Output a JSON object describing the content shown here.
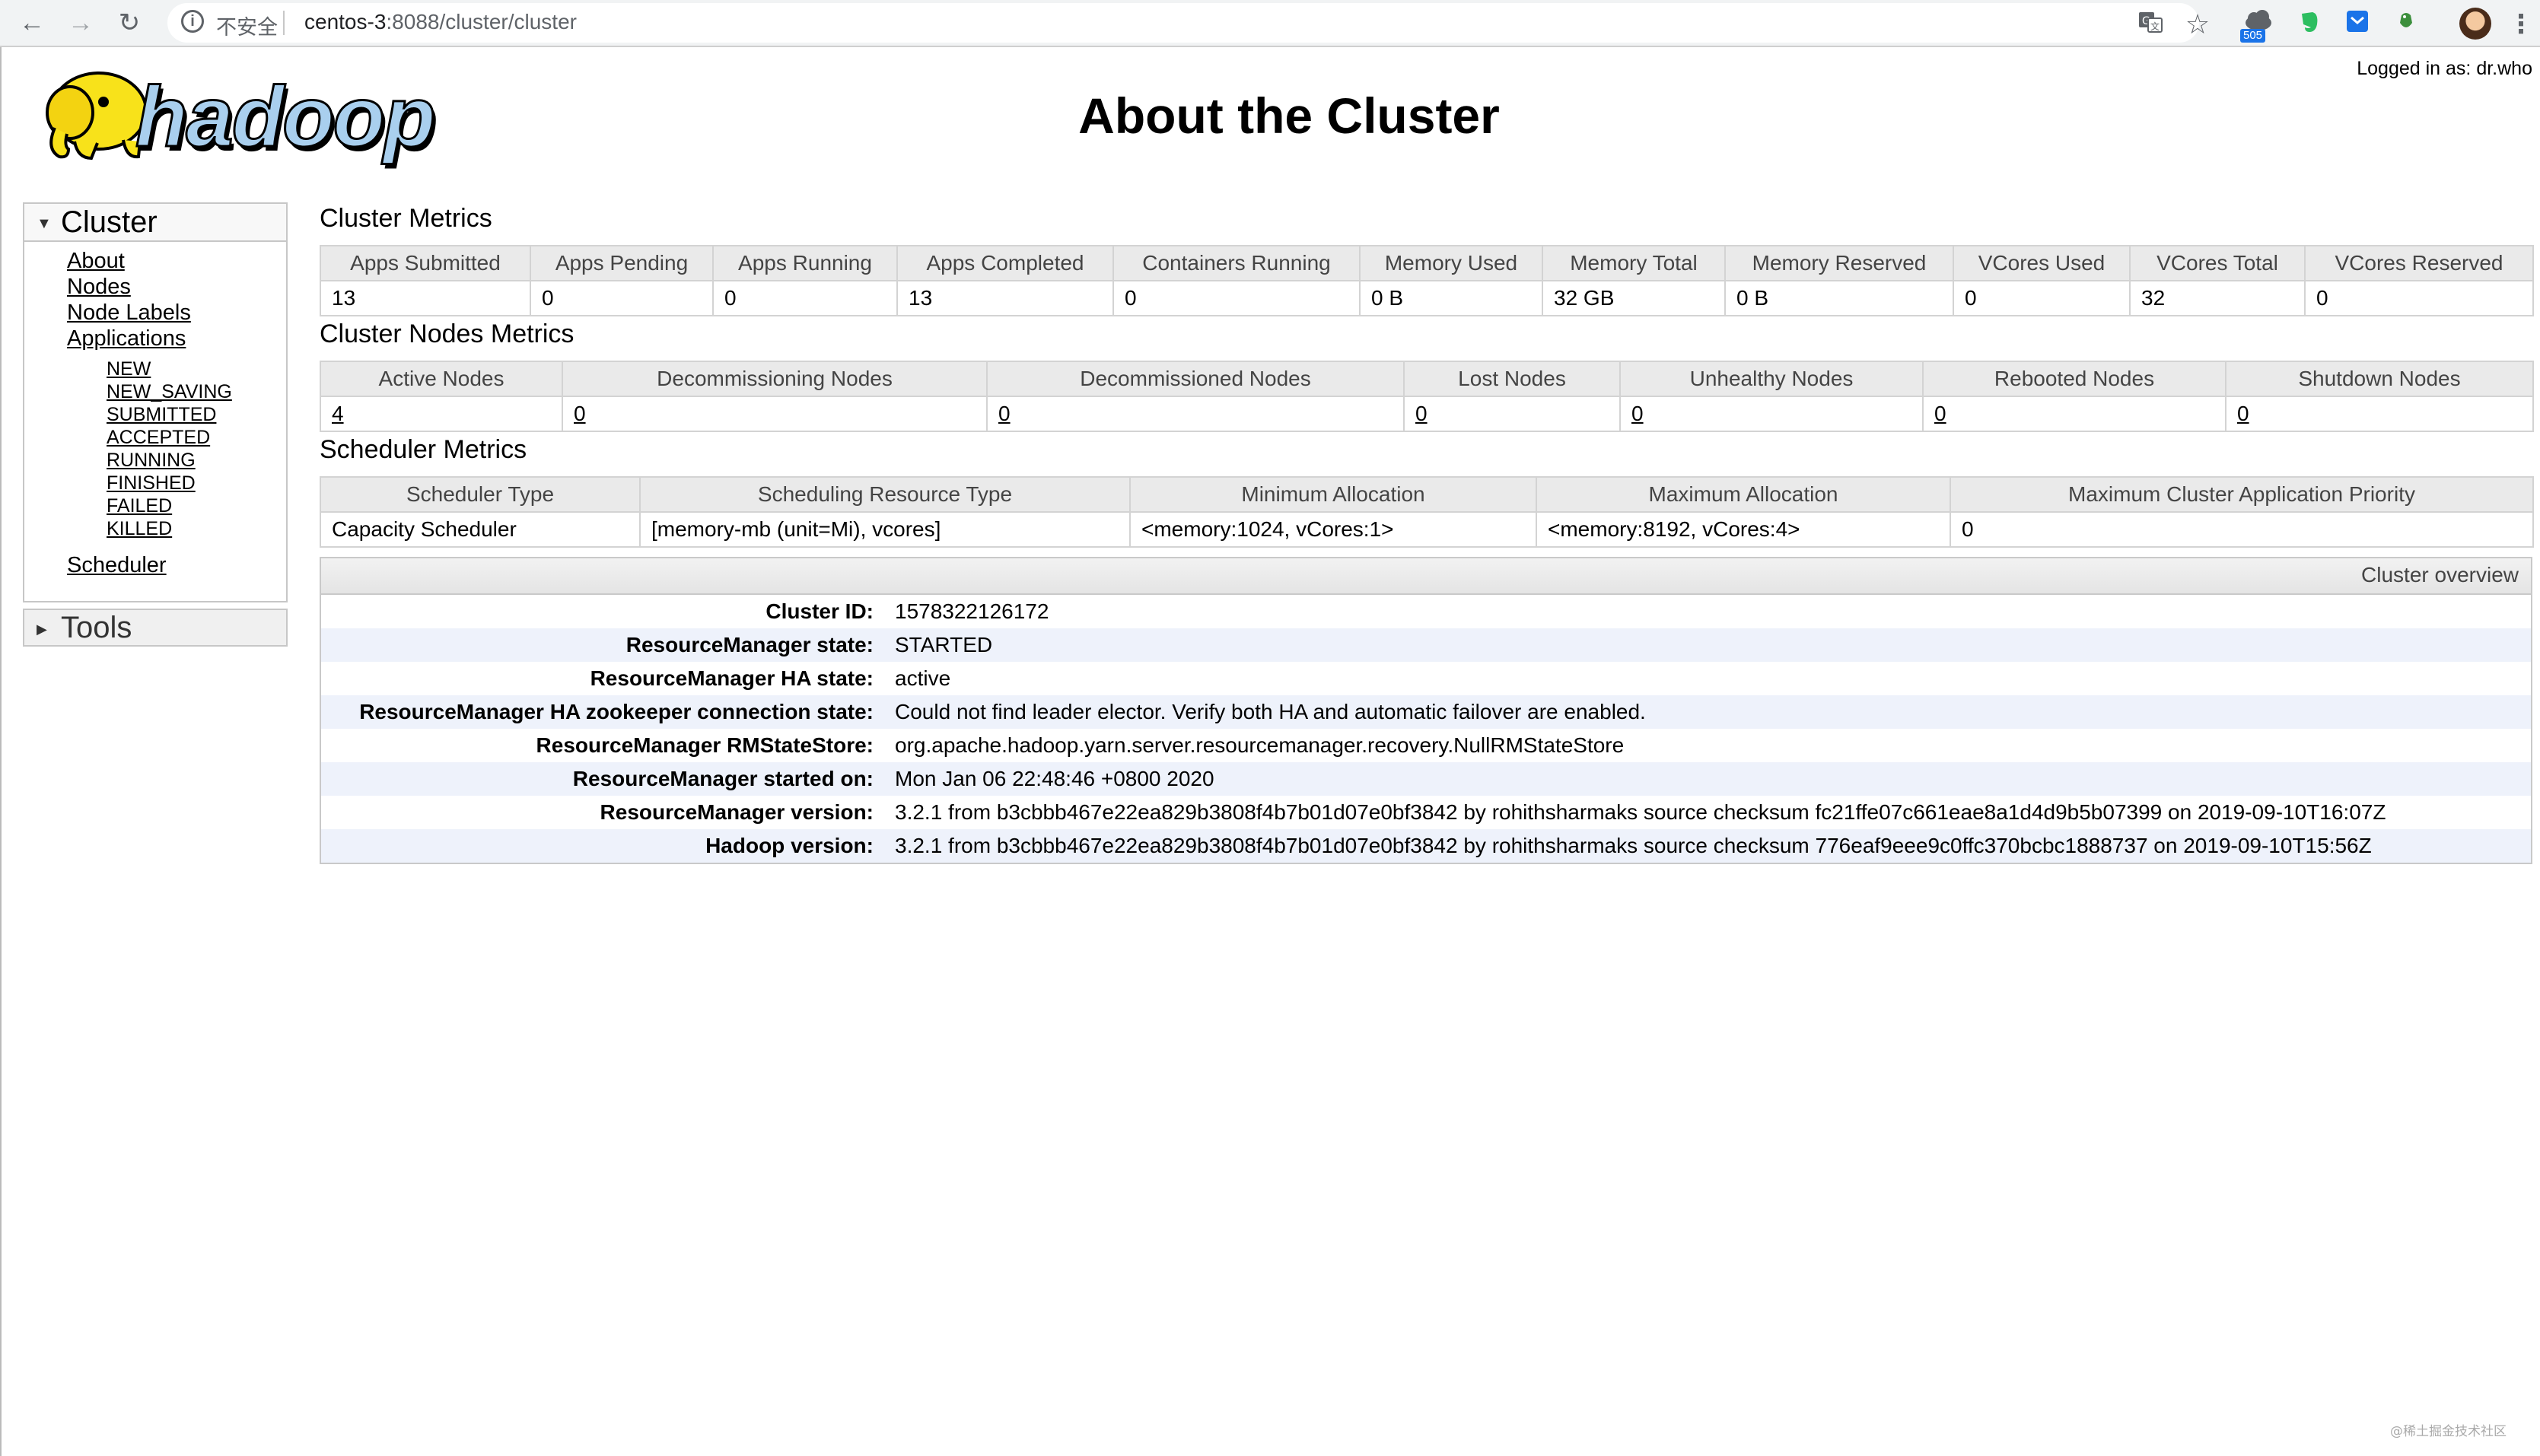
{
  "browser": {
    "back_icon": "arrow-left-icon",
    "forward_icon": "arrow-right-icon",
    "reload_icon": "reload-icon",
    "security_label": "不安全",
    "url_host": "centos-3",
    "url_path": ":8088/cluster/cluster",
    "extension_badge": "505"
  },
  "header": {
    "logo_text": "hadoop",
    "title": "About the Cluster",
    "login_label": "Logged in as: ",
    "login_user": "dr.who"
  },
  "sidebar": {
    "cluster_label": "Cluster",
    "links": {
      "about": "About",
      "nodes": "Nodes",
      "node_labels": "Node Labels",
      "applications": "Applications",
      "scheduler": "Scheduler"
    },
    "app_states": [
      "NEW",
      "NEW_SAVING",
      "SUBMITTED",
      "ACCEPTED",
      "RUNNING",
      "FINISHED",
      "FAILED",
      "KILLED"
    ],
    "tools_label": "Tools"
  },
  "cluster_metrics": {
    "title": "Cluster Metrics",
    "headers": [
      "Apps Submitted",
      "Apps Pending",
      "Apps Running",
      "Apps Completed",
      "Containers Running",
      "Memory Used",
      "Memory Total",
      "Memory Reserved",
      "VCores Used",
      "VCores Total",
      "VCores Reserved"
    ],
    "values": [
      "13",
      "0",
      "0",
      "13",
      "0",
      "0 B",
      "32 GB",
      "0 B",
      "0",
      "32",
      "0"
    ]
  },
  "node_metrics": {
    "title": "Cluster Nodes Metrics",
    "headers": [
      "Active Nodes",
      "Decommissioning Nodes",
      "Decommissioned Nodes",
      "Lost Nodes",
      "Unhealthy Nodes",
      "Rebooted Nodes",
      "Shutdown Nodes"
    ],
    "values": [
      "4",
      "0",
      "0",
      "0",
      "0",
      "0",
      "0"
    ]
  },
  "scheduler_metrics": {
    "title": "Scheduler Metrics",
    "headers": [
      "Scheduler Type",
      "Scheduling Resource Type",
      "Minimum Allocation",
      "Maximum Allocation",
      "Maximum Cluster Application Priority"
    ],
    "values": [
      "Capacity Scheduler",
      "[memory-mb (unit=Mi), vcores]",
      "<memory:1024, vCores:1>",
      "<memory:8192, vCores:4>",
      "0"
    ]
  },
  "overview": {
    "title": "Cluster overview",
    "rows": [
      {
        "label": "Cluster ID:",
        "value": "1578322126172"
      },
      {
        "label": "ResourceManager state:",
        "value": "STARTED"
      },
      {
        "label": "ResourceManager HA state:",
        "value": "active"
      },
      {
        "label": "ResourceManager HA zookeeper connection state:",
        "value": "Could not find leader elector. Verify both HA and automatic failover are enabled."
      },
      {
        "label": "ResourceManager RMStateStore:",
        "value": "org.apache.hadoop.yarn.server.resourcemanager.recovery.NullRMStateStore"
      },
      {
        "label": "ResourceManager started on:",
        "value": "Mon Jan 06 22:48:46 +0800 2020"
      },
      {
        "label": "ResourceManager version:",
        "value": "3.2.1 from b3cbbb467e22ea829b3808f4b7b01d07e0bf3842 by rohithsharmaks source checksum fc21ffe07c661eae8a1d4d9b5b07399 on 2019-09-10T16:07Z"
      },
      {
        "label": "Hadoop version:",
        "value": "3.2.1 from b3cbbb467e22ea829b3808f4b7b01d07e0bf3842 by rohithsharmaks source checksum 776eaf9eee9c0ffc370bcbc1888737 on 2019-09-10T15:56Z"
      }
    ]
  },
  "watermark": "@稀土掘金技术社区",
  "colors": {
    "table_header_bg": "#eaeaea",
    "row_alt_bg": "#eef2fb",
    "border": "#d3d3d3"
  }
}
